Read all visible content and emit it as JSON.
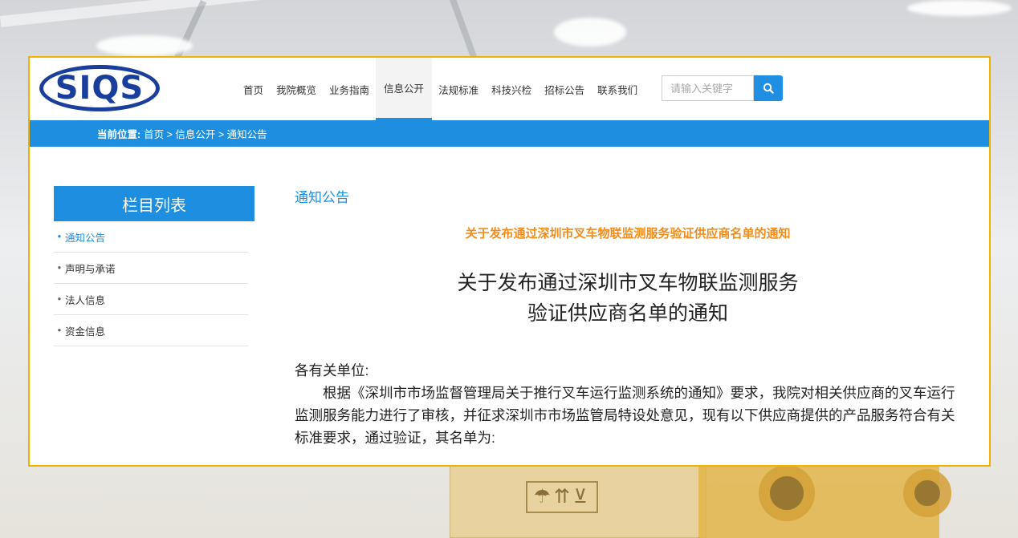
{
  "logo": {
    "text": "SIQS"
  },
  "nav": {
    "items": [
      {
        "label": "首页"
      },
      {
        "label": "我院概览"
      },
      {
        "label": "业务指南"
      },
      {
        "label": "信息公开",
        "active": true
      },
      {
        "label": "法规标准"
      },
      {
        "label": "科技兴检"
      },
      {
        "label": "招标公告"
      },
      {
        "label": "联系我们"
      }
    ],
    "search_placeholder": "请输入关键字",
    "search_icon": "search-icon"
  },
  "breadcrumb": {
    "label": "当前位置:",
    "path": "首页 > 信息公开 > 通知公告"
  },
  "sidebar": {
    "title": "栏目列表",
    "items": [
      {
        "label": "通知公告",
        "active": true
      },
      {
        "label": "声明与承诺"
      },
      {
        "label": "法人信息"
      },
      {
        "label": "资金信息"
      }
    ]
  },
  "content": {
    "section_title": "通知公告",
    "article_title": "关于发布通过深圳市叉车物联监测服务验证供应商名单的通知",
    "doc_title_line1": "关于发布通过深圳市叉车物联监测服务",
    "doc_title_line2": "验证供应商名单的通知",
    "greeting": "各有关单位:",
    "paragraph": "根据《深圳市市场监督管理局关于推行叉车运行监测系统的通知》要求，我院对相关供应商的叉车运行监测服务能力进行了审核，并征求深圳市市场监管局特设处意见，现有以下供应商提供的产品服务符合有关标准要求，通过验证，其名单为:"
  },
  "colors": {
    "accent": "#1e8fe0",
    "article_title": "#f28c1c",
    "frame_border": "#f0b400"
  }
}
